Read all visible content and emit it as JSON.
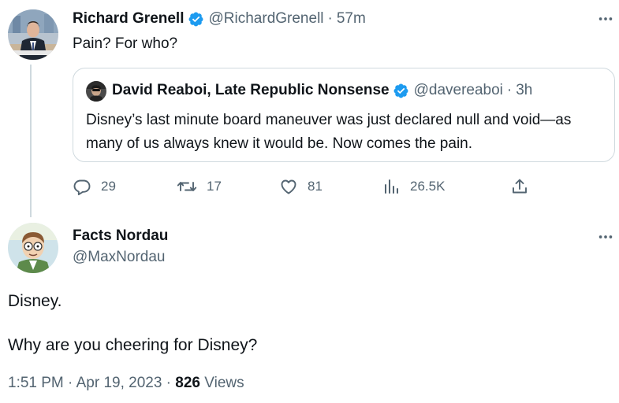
{
  "colors": {
    "verified_blue": "#1d9bf0",
    "text_primary": "#0f1419",
    "text_secondary": "#536471",
    "border": "#cfd9de"
  },
  "tweet": {
    "author_name": "Richard Grenell",
    "handle": "@RichardGrenell",
    "time": "57m",
    "verified": true,
    "text": "Pain? For who?",
    "quote": {
      "author_name": "David Reaboi, Late Republic Nonsense",
      "handle": "@davereaboi",
      "time": "3h",
      "verified": true,
      "text": "Disney’s last minute board maneuver was just declared null and void—as many of us always knew it would be. Now comes the pain."
    },
    "actions": {
      "replies": "29",
      "reposts": "17",
      "likes": "81",
      "views": "26.5K"
    }
  },
  "reply": {
    "author_name": "Facts Nordau",
    "handle": "@MaxNordau",
    "line1": "Disney.",
    "line2": "Why are you cheering for Disney?",
    "timestamp": "1:51 PM · Apr 19, 2023 · ",
    "views_count": "826",
    "views_label": " Views"
  },
  "icons": {
    "reply": "reply-icon",
    "repost": "repost-icon",
    "like": "heart-icon",
    "views": "analytics-icon",
    "share": "share-icon",
    "more": "more-icon",
    "verified": "verified-badge-icon"
  }
}
